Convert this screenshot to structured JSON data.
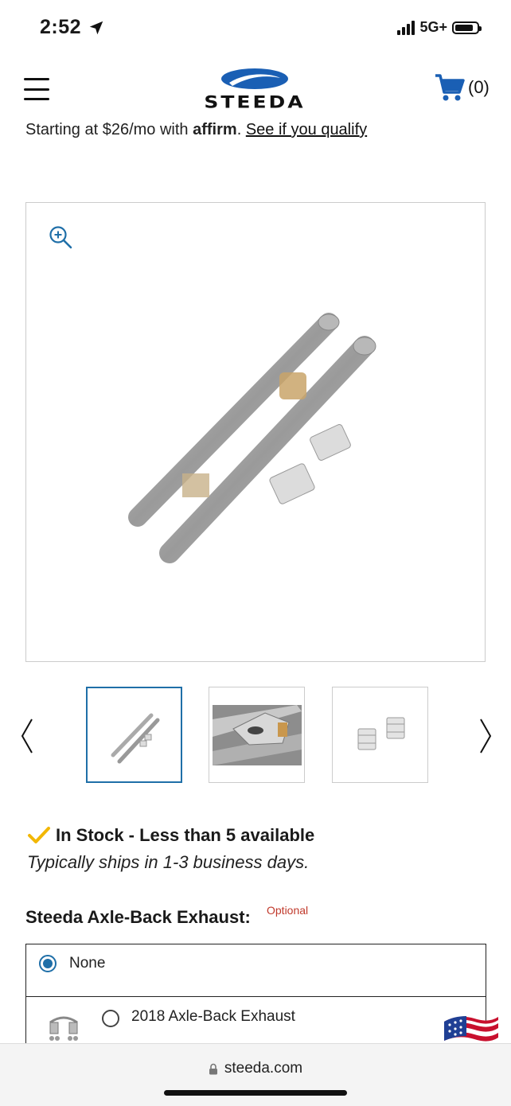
{
  "status_bar": {
    "time": "2:52",
    "network": "5G+"
  },
  "header": {
    "logo_text": "STEEDA",
    "cart_count": "(0)"
  },
  "affirm": {
    "prefix": "Starting at $26/mo with ",
    "brand": "affirm",
    "separator": ". ",
    "link": "See if you qualify"
  },
  "gallery": {
    "thumbnail_count": 3,
    "active_index": 0
  },
  "stock": {
    "status": "In Stock - Less than 5 available",
    "shipping": "Typically ships in 1-3 business days."
  },
  "option_group": {
    "label": "Steeda Axle-Back Exhaust:",
    "optional_tag": "Optional",
    "options": [
      {
        "label": "None",
        "selected": true
      },
      {
        "label": "2018 Axle-Back Exhaust",
        "selected": false
      }
    ]
  },
  "browser": {
    "url": "steeda.com"
  },
  "colors": {
    "accent": "#1f6fa8",
    "logo_blue": "#1a5fb4",
    "check_gold": "#f2b705",
    "optional_red": "#c0392b"
  }
}
